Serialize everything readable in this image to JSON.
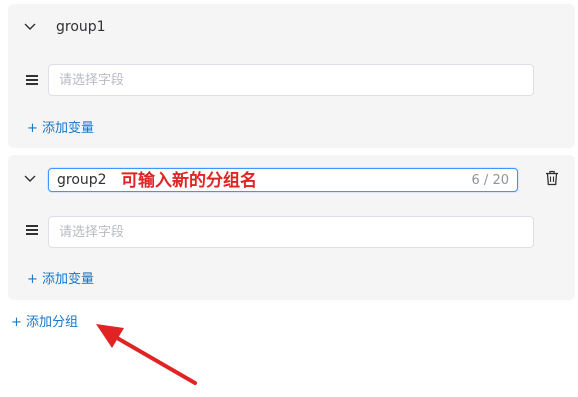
{
  "groups": [
    {
      "name": "group1",
      "field_placeholder": "请选择字段",
      "add_variable_label": "+ 添加变量"
    },
    {
      "name_value": "group2",
      "char_count": "6 / 20",
      "annotation": "可输入新的分组名",
      "field_placeholder": "请选择字段",
      "add_variable_label": "+ 添加变量"
    }
  ],
  "add_group_label": "+ 添加分组",
  "icons": {
    "collapse": "chevron-down-icon",
    "drag": "drag-handle-icon",
    "delete": "trash-icon",
    "annotation_arrow": "red-arrow"
  },
  "colors": {
    "link": "#1677c8",
    "annotation": "#e02424",
    "card_bg": "#f5f5f6",
    "focus_border": "#4096ff"
  }
}
